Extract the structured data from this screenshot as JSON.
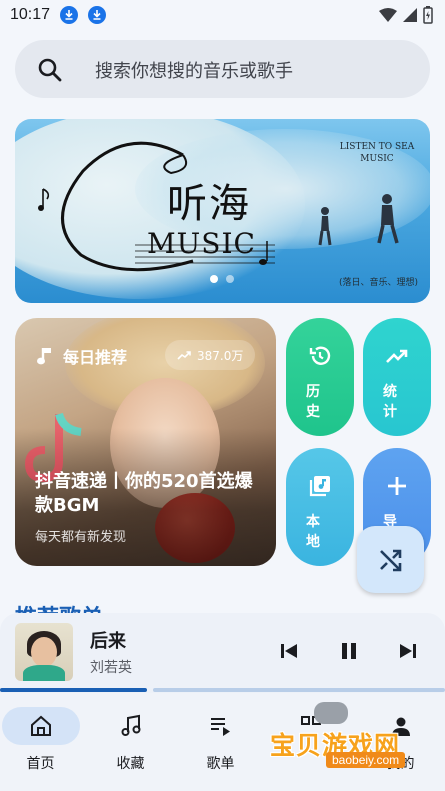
{
  "status_bar": {
    "time": "10:17"
  },
  "search": {
    "placeholder": "搜索你想搜的音乐或歌手"
  },
  "banner": {
    "title_en": "LISTEN TO SEA MUSIC",
    "title_cn": "听海",
    "music_word": "MUSIC",
    "subtitle": "(落日、音乐、理想)",
    "active_dot": 0,
    "dot_count": 2
  },
  "daily": {
    "label": "每日推荐",
    "plays": "387.0万",
    "title": "抖音速递丨你的520首选爆款BGM",
    "subtitle": "每天都有新发现"
  },
  "tiles": {
    "history": "历史",
    "stats": "统计",
    "local": "本地",
    "import": "导"
  },
  "section": {
    "heading": "推荐歌单"
  },
  "player": {
    "title": "后来",
    "artist": "刘若英",
    "progress": 0.33
  },
  "nav": {
    "items": [
      {
        "label": "首页",
        "icon": "home-icon",
        "active": true
      },
      {
        "label": "收藏",
        "icon": "music-note-icon",
        "active": false
      },
      {
        "label": "歌单",
        "icon": "playlist-icon",
        "active": false
      },
      {
        "label": "",
        "icon": "grid-icon",
        "active": false
      },
      {
        "label": "我的",
        "icon": "person-icon",
        "active": false
      }
    ]
  },
  "watermark": {
    "text": "宝贝游戏网",
    "url": "baobeiy.com"
  },
  "colors": {
    "accent": "#1a5fb4",
    "history": "#1fc48c",
    "stats": "#28c6d0",
    "local": "#3ab4e0",
    "import": "#4b8fea",
    "fab": "#d3e7fb"
  }
}
